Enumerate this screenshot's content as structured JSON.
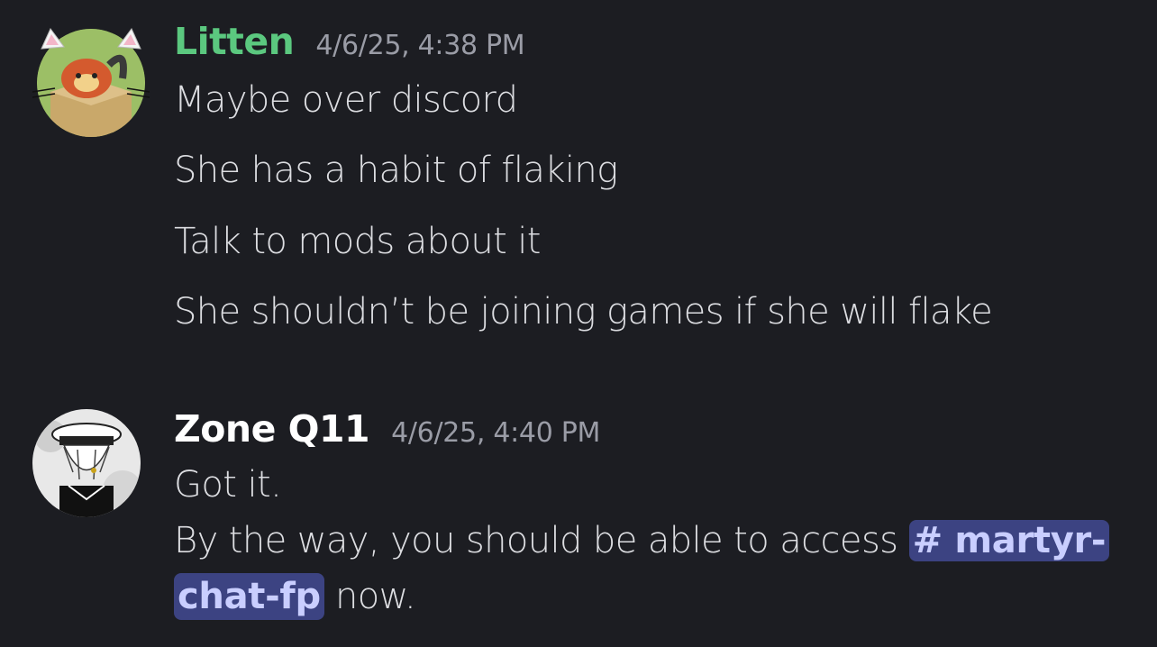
{
  "messages": [
    {
      "username": "Litten",
      "username_color": "#5bc87f",
      "timestamp": "4/6/25, 4:38 PM",
      "lines": [
        "Maybe over discord",
        "She has a habit of flaking",
        "Talk to mods about it",
        "She shouldn’t be joining games if she will flake"
      ]
    },
    {
      "username": "Zone Q11",
      "username_color": "#ffffff",
      "timestamp": "4/6/25, 4:40 PM",
      "lines": [
        "Got it.",
        "By the way, you should be able to access",
        "now."
      ],
      "mention_part1": "# martyr-",
      "mention_part2": "chat-fp"
    }
  ]
}
